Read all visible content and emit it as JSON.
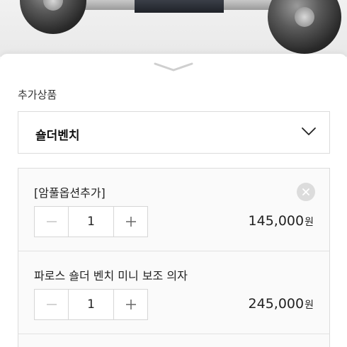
{
  "addon_section": {
    "title": "추가상품"
  },
  "addon_select": {
    "selected_value": "숄더벤치"
  },
  "selected_items": [
    {
      "name": "[암풀옵션추가]",
      "quantity": "1",
      "price": "145,000",
      "currency": "원",
      "removable": true
    },
    {
      "name": "파로스 숄더 벤치 미니 보조 의자",
      "quantity": "1",
      "price": "245,000",
      "currency": "원",
      "removable": false
    }
  ],
  "icons": {
    "sheet_handle": "chevron-down-icon",
    "select_chevron": "chevron-down-icon",
    "remove": "close-icon",
    "minus": "minus-icon",
    "plus": "plus-icon"
  },
  "colors": {
    "border": "#dcdcdc",
    "item_background": "#fafafa",
    "remove_button": "#dcdcdc",
    "text": "#222222"
  }
}
